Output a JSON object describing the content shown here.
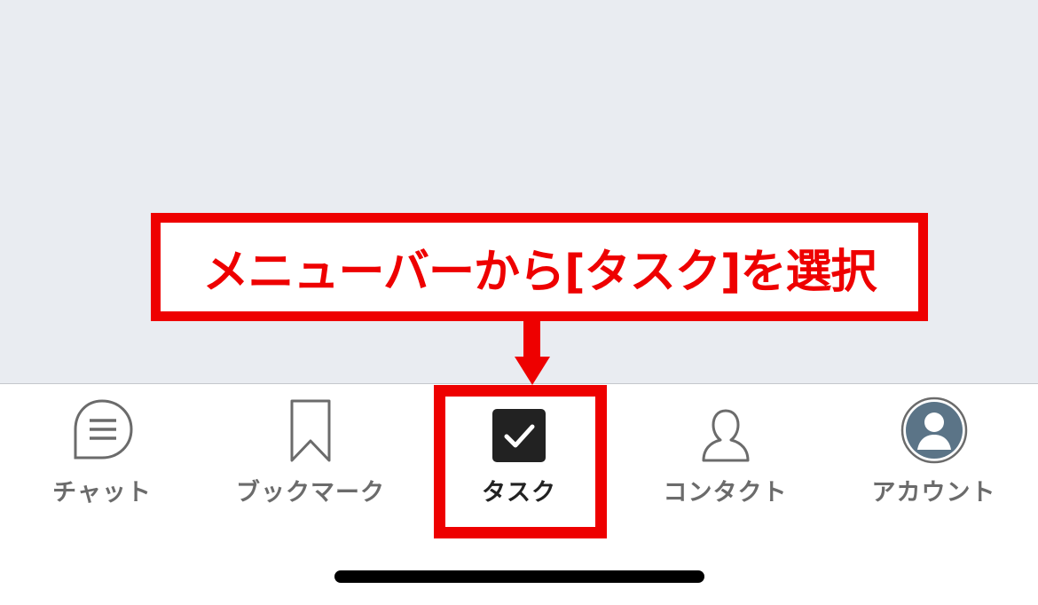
{
  "tab_bar": {
    "items": [
      {
        "label": "チャット",
        "icon": "chat-bubble-icon"
      },
      {
        "label": "ブックマーク",
        "icon": "bookmark-icon"
      },
      {
        "label": "タスク",
        "icon": "task-checkbox-icon",
        "active": true
      },
      {
        "label": "コンタクト",
        "icon": "contact-person-icon"
      },
      {
        "label": "アカウント",
        "icon": "account-avatar-icon"
      }
    ]
  },
  "annotation": {
    "callout_text": "メニューバーから[タスク]を選択",
    "color": "#ee0000"
  },
  "colors": {
    "content_background": "#e9ecf1",
    "tab_bar_background": "#ffffff",
    "inactive_label": "#6b6b6b",
    "active_label": "#222222"
  }
}
